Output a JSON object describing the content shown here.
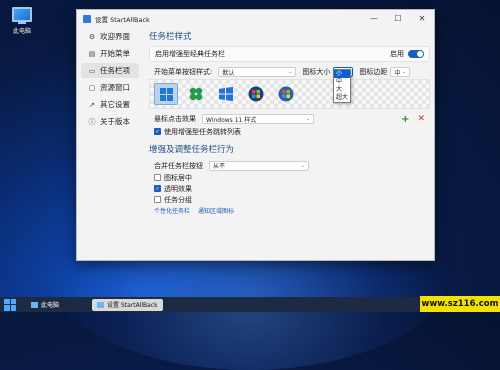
{
  "desktop": {
    "icon_label": "此电脑"
  },
  "window": {
    "title": "设置 StartAllBack",
    "controls": {
      "minimize": "—",
      "maximize": "☐",
      "close": "✕"
    }
  },
  "sidebar": {
    "items": [
      {
        "label": "欢迎界面",
        "icon": "gear-icon",
        "glyph": "⚙"
      },
      {
        "label": "开始菜单",
        "icon": "start-menu-icon",
        "glyph": "▤"
      },
      {
        "label": "任务栏项",
        "icon": "taskbar-icon",
        "glyph": "▭"
      },
      {
        "label": "资源窗口",
        "icon": "folder-icon",
        "glyph": "▢"
      },
      {
        "label": "其它设置",
        "icon": "settings-icon",
        "glyph": "↗"
      },
      {
        "label": "关于版本",
        "icon": "info-icon",
        "glyph": "ⓘ"
      }
    ]
  },
  "taskbar_style": {
    "section_title": "任务栏样式",
    "enhanced_classic_label": "启用增强型经典任务栏",
    "enhanced_classic_state": "启用",
    "start_button_style_label": "开始菜单按钮样式:",
    "start_button_style_value": "默认",
    "icon_size_label": "图标大小",
    "icon_size_value": "小",
    "icon_margin_label": "图标边距",
    "icon_margin_value": "中",
    "icon_size_options": [
      "小",
      "中",
      "大",
      "超大"
    ],
    "start_buttons": [
      "windows-11",
      "flower",
      "windows-10",
      "vista-orb",
      "xp-orb"
    ],
    "click_effect_label": "悬标点击效果",
    "click_effect_value": "Windows 11 样式",
    "use_jumplist_label": "使用增强型任务跳转列表",
    "add_glyph": "+",
    "remove_glyph": "✕"
  },
  "enhance_section": {
    "section_title": "增强及调整任务栏行为",
    "combine_label": "合并任务栏按钮",
    "combine_value": "从不",
    "checks": [
      {
        "label": "图标居中",
        "checked": false
      },
      {
        "label": "透明效果",
        "checked": true
      },
      {
        "label": "任务分组",
        "checked": false
      }
    ],
    "link_personalize": "个性化任务栏",
    "link_tray": "通知区域图标"
  },
  "taskbar": {
    "items": [
      {
        "label": "此电脑"
      },
      {
        "label": "设置 StartAllBack"
      }
    ]
  },
  "watermark": "www.sz116.com",
  "colors": {
    "accent": "#1c5fb8",
    "watermark_bg": "#f2e100"
  }
}
